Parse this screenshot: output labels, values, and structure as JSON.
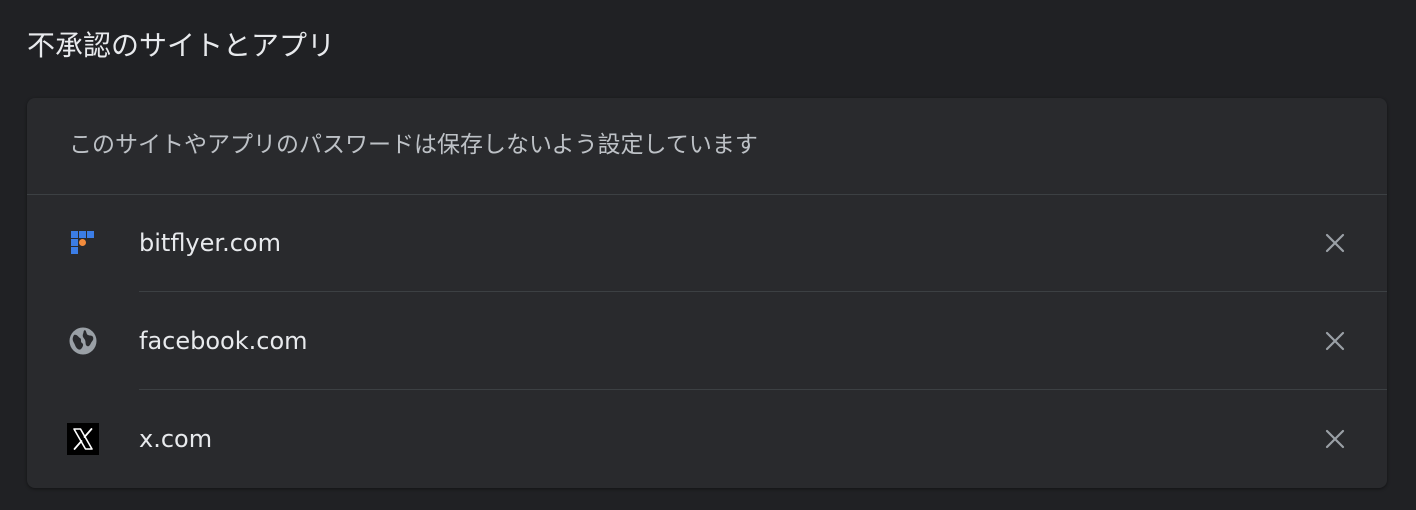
{
  "section": {
    "title": "不承認のサイトとアプリ"
  },
  "card": {
    "description": "このサイトやアプリのパスワードは保存しないよう設定しています"
  },
  "sites": [
    {
      "name": "bitflyer.com",
      "icon": "bitflyer-logo-icon"
    },
    {
      "name": "facebook.com",
      "icon": "globe-icon"
    },
    {
      "name": "x.com",
      "icon": "x-logo-icon"
    }
  ],
  "colors": {
    "background": "#202124",
    "card": "#292a2d",
    "divider": "#3c4043",
    "text_primary": "#e8eaed",
    "text_secondary": "#bdc1c6",
    "icon_gray": "#9aa0a6",
    "bitflyer_blue": "#3b7de6",
    "bitflyer_orange": "#f28b3c"
  }
}
